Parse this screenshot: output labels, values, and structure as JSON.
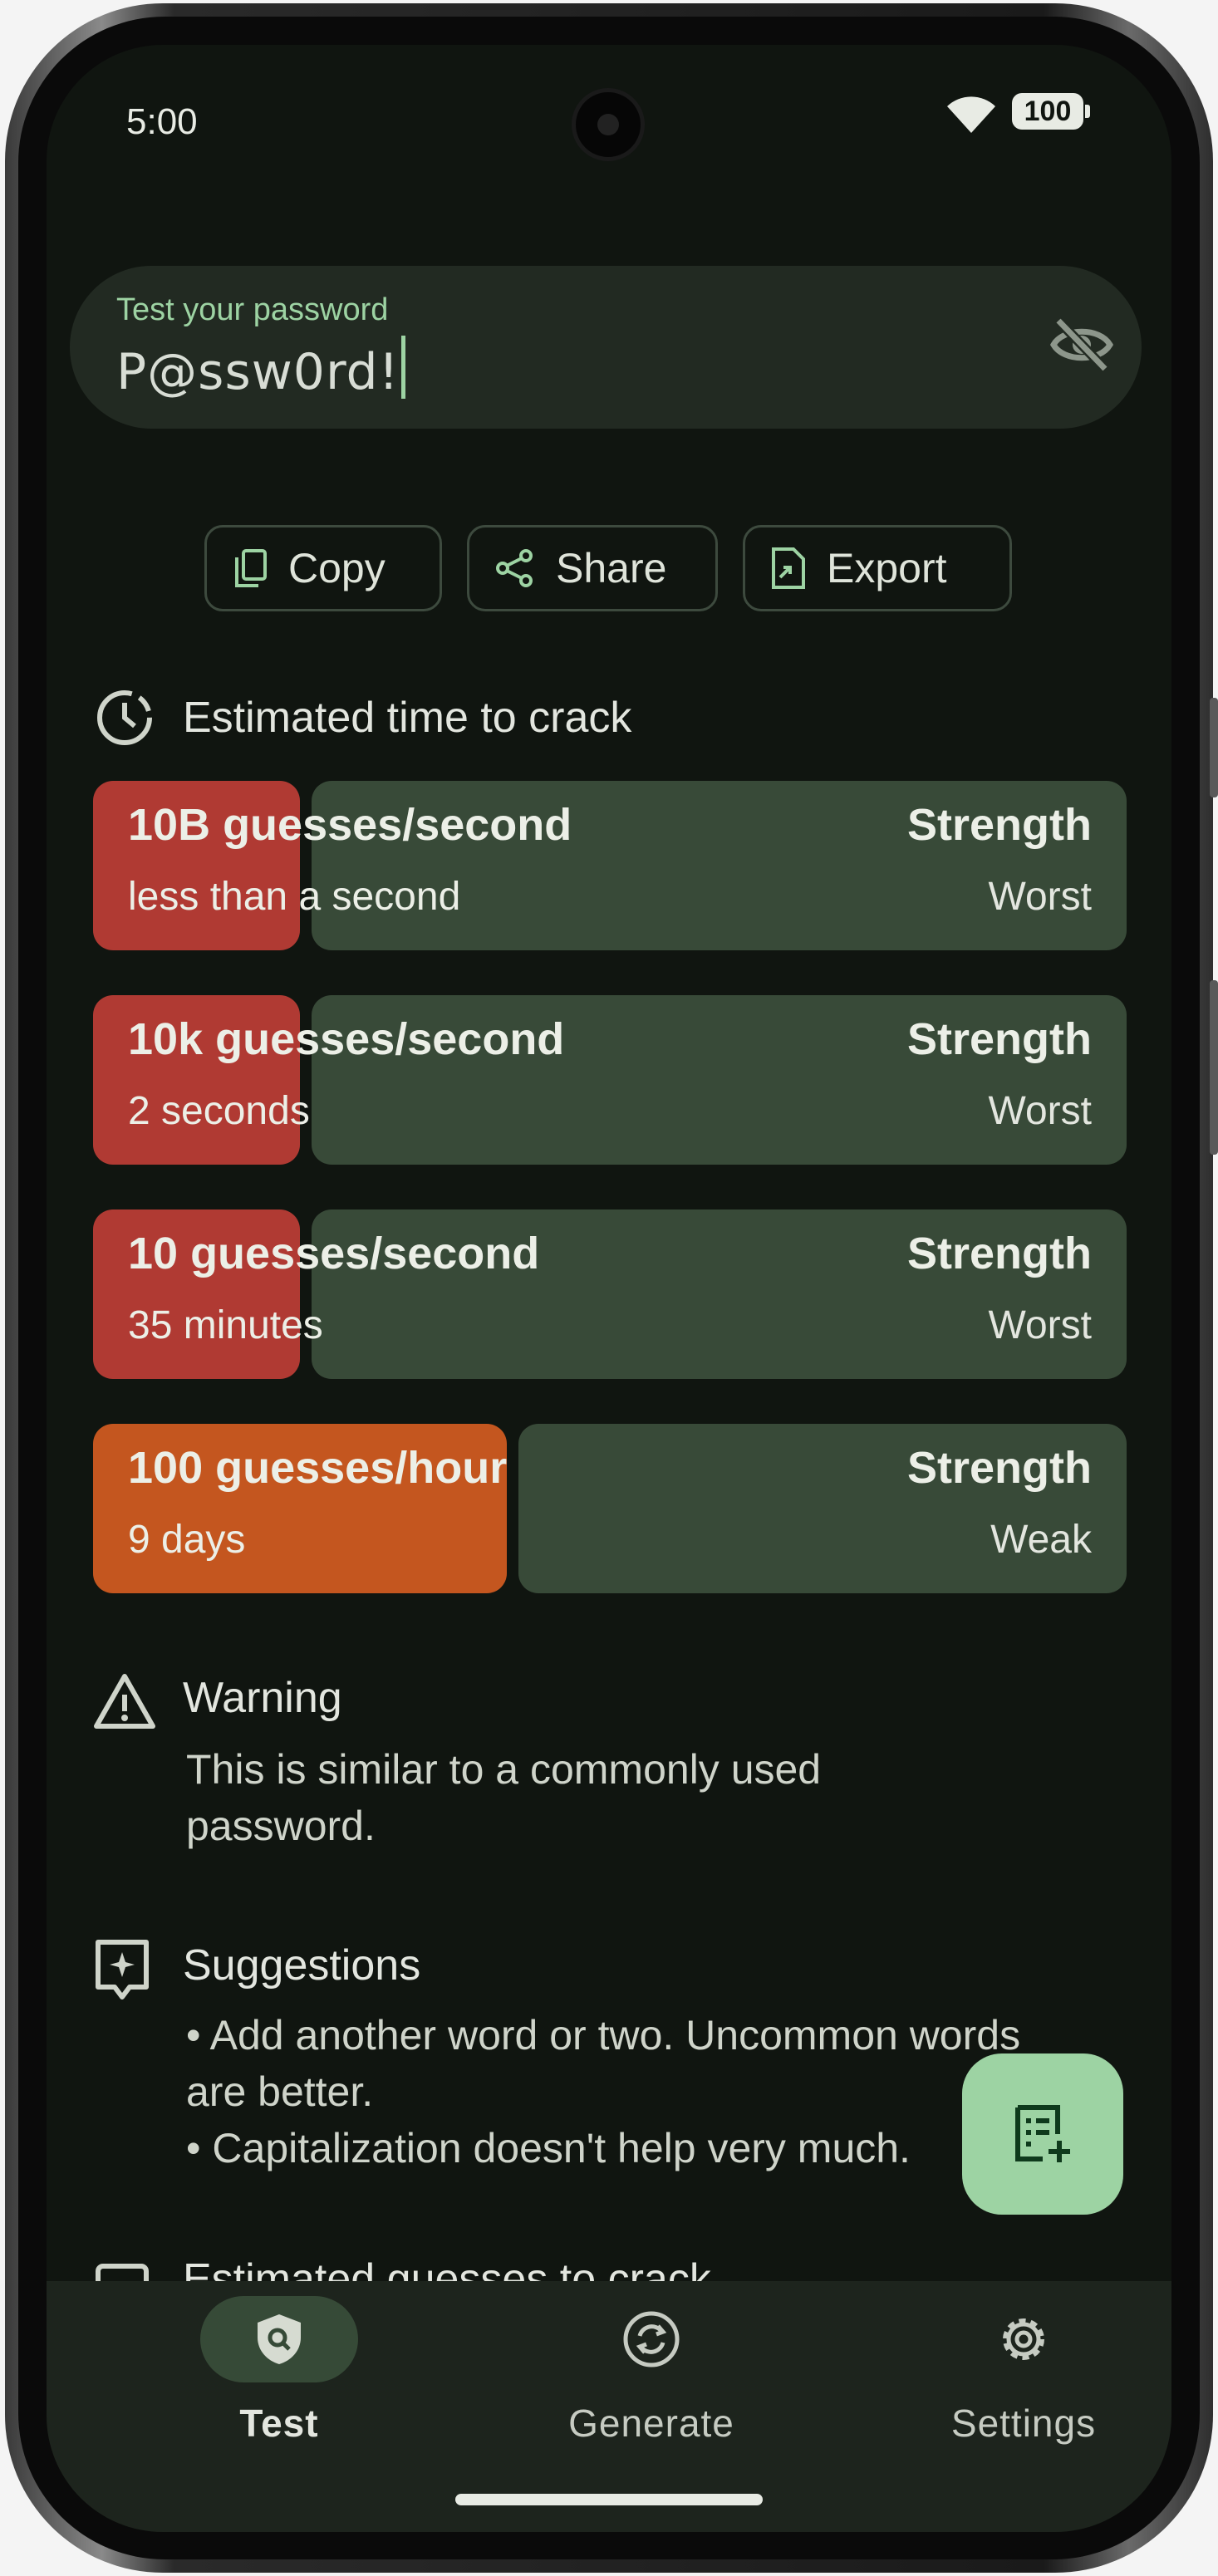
{
  "status_bar": {
    "time": "5:00",
    "battery": "100"
  },
  "password_field": {
    "label": "Test your password",
    "value": "P@ssw0rd!"
  },
  "actions": {
    "copy": "Copy",
    "share": "Share",
    "export": "Export"
  },
  "crack_time": {
    "title": "Estimated time to crack",
    "rows": [
      {
        "rate": "10B guesses/second",
        "time": "less than a second",
        "strength_label": "Strength",
        "strength": "Worst",
        "fill_fraction": 0.2,
        "color": "#b03a33"
      },
      {
        "rate": "10k guesses/second",
        "time": "2 seconds",
        "strength_label": "Strength",
        "strength": "Worst",
        "fill_fraction": 0.2,
        "color": "#b03a33"
      },
      {
        "rate": "10 guesses/second",
        "time": "35 minutes",
        "strength_label": "Strength",
        "strength": "Worst",
        "fill_fraction": 0.2,
        "color": "#b03a33"
      },
      {
        "rate": "100 guesses/hour",
        "time": "9 days",
        "strength_label": "Strength",
        "strength": "Weak",
        "fill_fraction": 0.4,
        "color": "#c4561f"
      }
    ]
  },
  "warning": {
    "title": "Warning",
    "text": "This is similar to a commonly used password."
  },
  "suggestions": {
    "title": "Suggestions",
    "items": [
      "• Add another word or two. Uncommon words are better.",
      "• Capitalization doesn't help very much."
    ]
  },
  "next_section_title": "Estimated guesses to crack",
  "nav": {
    "test": "Test",
    "generate": "Generate",
    "settings": "Settings",
    "active": "test"
  },
  "colors": {
    "accent": "#9dd3a3",
    "background": "#101510",
    "track": "#384a38",
    "worst": "#b03a33",
    "weak": "#c4561f"
  }
}
